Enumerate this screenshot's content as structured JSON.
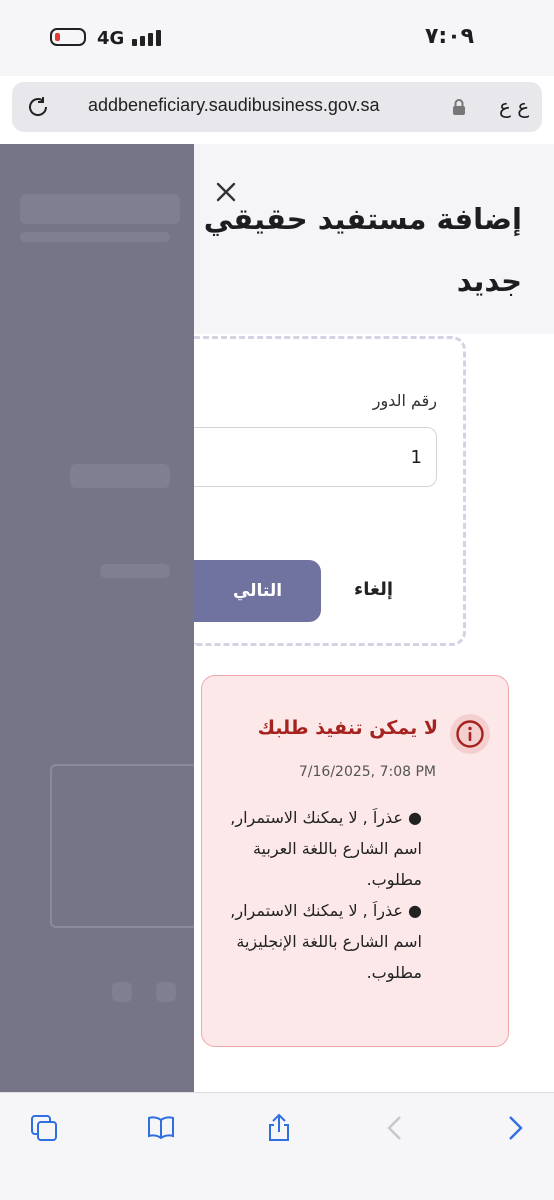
{
  "status_bar": {
    "time": "٧:٠٩",
    "network": "4G"
  },
  "browser": {
    "url": "addbeneficiary.saudibusiness.gov.sa",
    "text_size_label": "ع ع"
  },
  "panel": {
    "title": "إضافة مستفيد حقيقي جديد",
    "floor_label": "رقم الدور",
    "floor_value": "1",
    "next_label": "التالي",
    "cancel_label": "إلغاء"
  },
  "alert": {
    "title": "لا يمكن تنفيذ طلبك",
    "timestamp": "7/16/2025, 7:08 PM",
    "messages": [
      "عذراَ , لا يمكنك الاستمرار, اسم الشارع باللغة العربية مطلوب.",
      "عذراَ , لا يمكنك الاستمرار, اسم الشارع باللغة الإنجليزية مطلوب."
    ]
  },
  "colors": {
    "primary_button": "#70739f",
    "alert_background": "#fce8e8",
    "alert_border": "#eea7a7",
    "alert_title": "#a5221e",
    "overlay": "#757587"
  },
  "icons": [
    "battery-icon",
    "signal-icon",
    "reload-icon",
    "lock-icon",
    "close-icon",
    "info-icon",
    "tabs-icon",
    "bookmarks-icon",
    "share-icon",
    "back-icon",
    "forward-icon"
  ]
}
